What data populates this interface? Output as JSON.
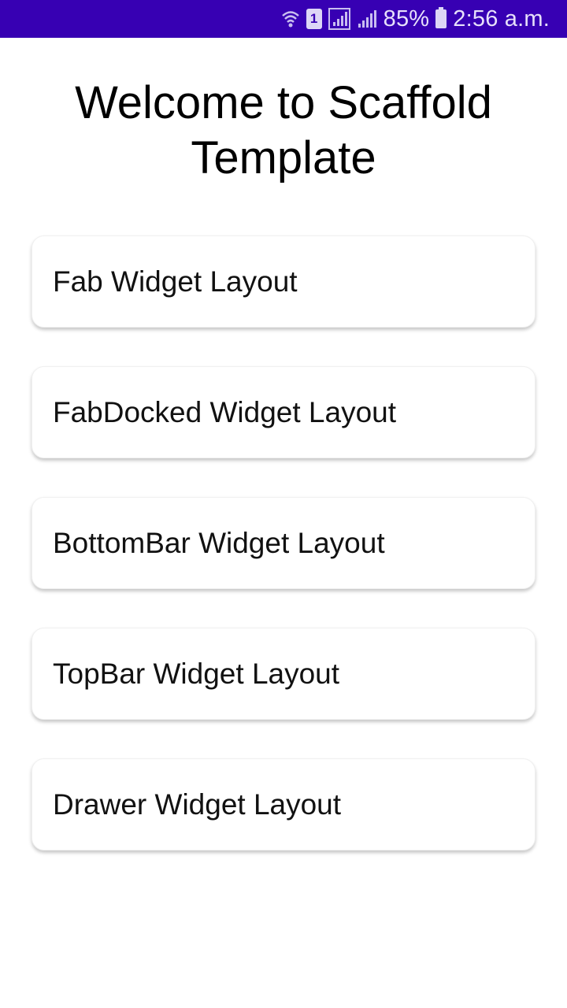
{
  "status_bar": {
    "background": "#3700b3",
    "icons": [
      "wifi-icon",
      "sim-1-icon",
      "signal-icon",
      "signal-icon",
      "battery-icon"
    ],
    "sim_label": "1",
    "battery_percent": "85%",
    "time": "2:56 a.m."
  },
  "main": {
    "title": "Welcome to Scaffold Template",
    "items": [
      {
        "label": "Fab Widget Layout"
      },
      {
        "label": "FabDocked Widget Layout"
      },
      {
        "label": "BottomBar Widget Layout"
      },
      {
        "label": "TopBar Widget Layout"
      },
      {
        "label": "Drawer Widget Layout"
      }
    ]
  }
}
